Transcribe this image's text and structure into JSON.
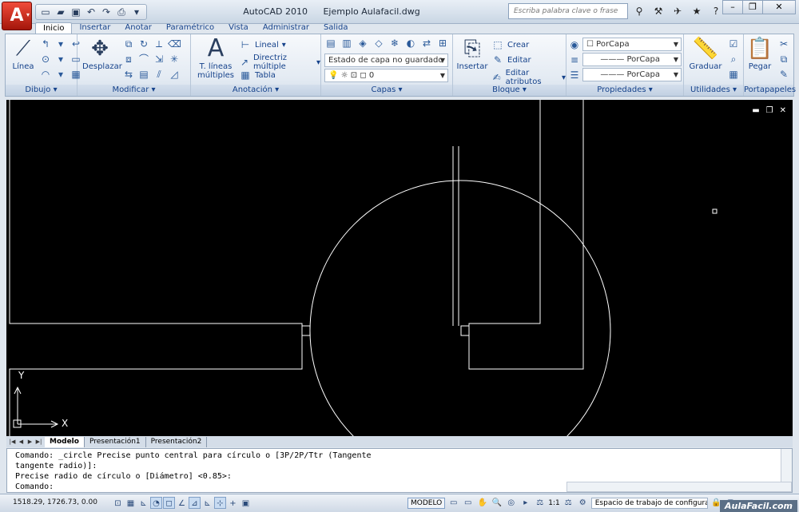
{
  "window": {
    "app_name": "AutoCAD 2010",
    "file_name": "Ejemplo Aulafacil.dwg",
    "search_placeholder": "Escriba palabra clave o frase",
    "app_button_label": "A",
    "minimize": "–",
    "restore": "❐",
    "close": "✕"
  },
  "quick_access": [
    {
      "icon": "new-file-icon",
      "glyph": "▭"
    },
    {
      "icon": "open-folder-icon",
      "glyph": "▰"
    },
    {
      "icon": "save-icon",
      "glyph": "▣"
    },
    {
      "icon": "undo-icon",
      "glyph": "↶"
    },
    {
      "icon": "redo-icon",
      "glyph": "↷"
    },
    {
      "icon": "print-icon",
      "glyph": "⎙"
    },
    {
      "icon": "customize-icon",
      "glyph": "▾"
    }
  ],
  "ribbon_tabs": [
    "Inicio",
    "Insertar",
    "Anotar",
    "Paramétrico",
    "Vista",
    "Administrar",
    "Salida"
  ],
  "ribbon": {
    "dibujo": {
      "title": "Dibujo",
      "linea": "Línea"
    },
    "modificar": {
      "title": "Modificar",
      "desplazar": "Desplazar"
    },
    "anotacion": {
      "title": "Anotación",
      "text_big": "T. líneas múltiples",
      "lineal": "Lineal",
      "directriz": "Directriz múltiple",
      "tabla": "Tabla"
    },
    "capas": {
      "title": "Capas",
      "estado": "Estado de capa no guardado",
      "layer": "0"
    },
    "bloque": {
      "title": "Bloque",
      "insertar": "Insertar",
      "crear": "Crear",
      "editar": "Editar",
      "editar_atributos": "Editar atributos"
    },
    "propiedades": {
      "title": "Propiedades",
      "color": "PorCapa",
      "linetype": "PorCapa",
      "lineweight": "PorCapa"
    },
    "utilidades": {
      "title": "Utilidades",
      "graduar": "Graduar"
    },
    "portapapeles": {
      "title": "Portapapeles",
      "pegar": "Pegar"
    }
  },
  "canvas": {
    "axis_y": "Y",
    "axis_x": "X"
  },
  "layout_tabs": [
    "Modelo",
    "Presentación1",
    "Presentación2"
  ],
  "command": {
    "lines": [
      "Comando: _circle Precise punto central para círculo o [3P/2P/Ttr (Tangente",
      "tangente radio)]:",
      "Precise radio de círculo o [Diámetro] <0.85>:"
    ],
    "prompt": "Comando:"
  },
  "status": {
    "coords": "1518.29, 1726.73, 0.00",
    "modelo": "MODELO",
    "scale": "1:1",
    "workspace": "Espacio de trabajo de configura"
  },
  "watermark": "AulaFacil.com",
  "colors": {
    "canvas_bg": "#000000",
    "lines": "#ffffff",
    "accent": "#15428b"
  }
}
